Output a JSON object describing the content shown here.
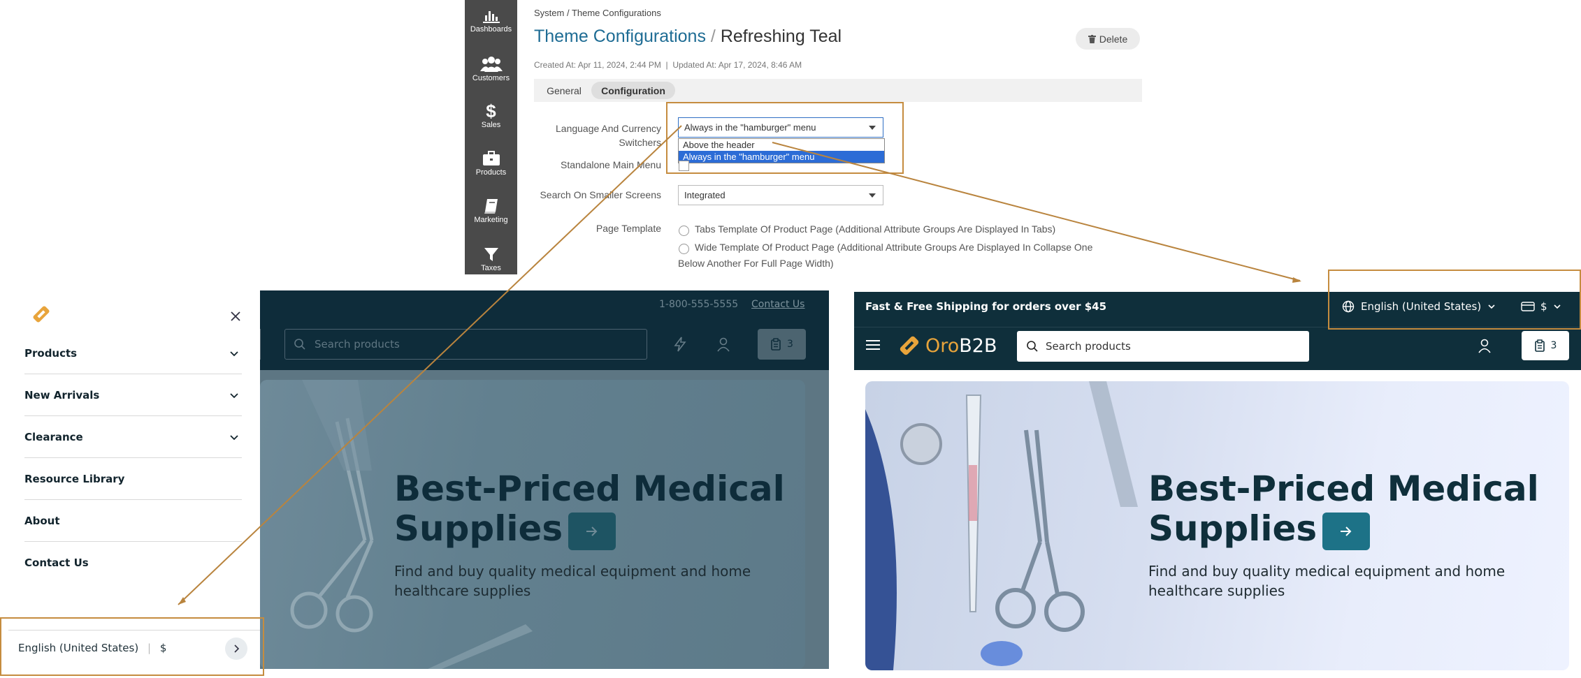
{
  "admin": {
    "sidebar": [
      {
        "label": "Dashboards",
        "icon": "bar-chart-icon"
      },
      {
        "label": "Customers",
        "icon": "users-icon"
      },
      {
        "label": "Sales",
        "icon": "dollar-icon"
      },
      {
        "label": "Products",
        "icon": "briefcase-icon"
      },
      {
        "label": "Marketing",
        "icon": "book-icon"
      },
      {
        "label": "Taxes",
        "icon": "filter-icon"
      }
    ],
    "breadcrumb": "System / Theme Configurations",
    "title_link": "Theme Configurations",
    "title_sep": "/",
    "title_name": "Refreshing Teal",
    "delete_label": "Delete",
    "meta": "Created At: Apr 11, 2024, 2:44 PM  |  Updated At: Apr 17, 2024, 8:46 AM",
    "tabs": [
      {
        "label": "General",
        "active": false
      },
      {
        "label": "Configuration",
        "active": true
      }
    ],
    "fields": {
      "lang_label_1": "Language And Currency",
      "lang_label_2": "Switchers",
      "lang_value": "Always in the \"hamburger\" menu",
      "lang_options": [
        "Above the header",
        "Always in the \"hamburger\" menu"
      ],
      "standalone_label": "Standalone Main Menu",
      "search_label": "Search On Smaller Screens",
      "search_value": "Integrated",
      "page_template_label": "Page Template",
      "page_template_opt1": "Tabs Template Of Product Page (Additional Attribute Groups Are Displayed In Tabs)",
      "page_template_opt2a": "Wide Template Of Product Page (Additional Attribute Groups Are Displayed In Collapse One",
      "page_template_opt2b": "Below Another For Full Page Width)"
    }
  },
  "storefront_left": {
    "phone": "1-800-555-5555",
    "contact": "Contact Us",
    "search_placeholder": "Search products",
    "cart_count": "3",
    "hero_title_1": "Best-Priced Medical",
    "hero_title_2": "Supplies",
    "hero_sub_1": "Find and buy quality medical equipment and home",
    "hero_sub_2": "healthcare supplies"
  },
  "mobile_menu": {
    "items": [
      "Products",
      "New Arrivals",
      "Clearance",
      "Resource Library",
      "About",
      "Contact Us"
    ],
    "language": "English (United States)",
    "currency": "$"
  },
  "storefront_right": {
    "promo": "Fast & Free Shipping for orders over $45",
    "language": "English (United States)",
    "currency": "$",
    "logo_oro": "Oro",
    "logo_b2b": "B2B",
    "search_placeholder": "Search products",
    "cart_count": "3",
    "hero_title_1": "Best-Priced Medical",
    "hero_title_2": "Supplies",
    "hero_sub_1": "Find and buy quality medical equipment and home",
    "hero_sub_2": "healthcare supplies"
  },
  "colors": {
    "accent_link": "#1e6c94",
    "highlight": "#c58c3f",
    "store_dark": "#0f2f3b",
    "hero_button": "#1d7287",
    "selected_option": "#2c6cd6"
  }
}
